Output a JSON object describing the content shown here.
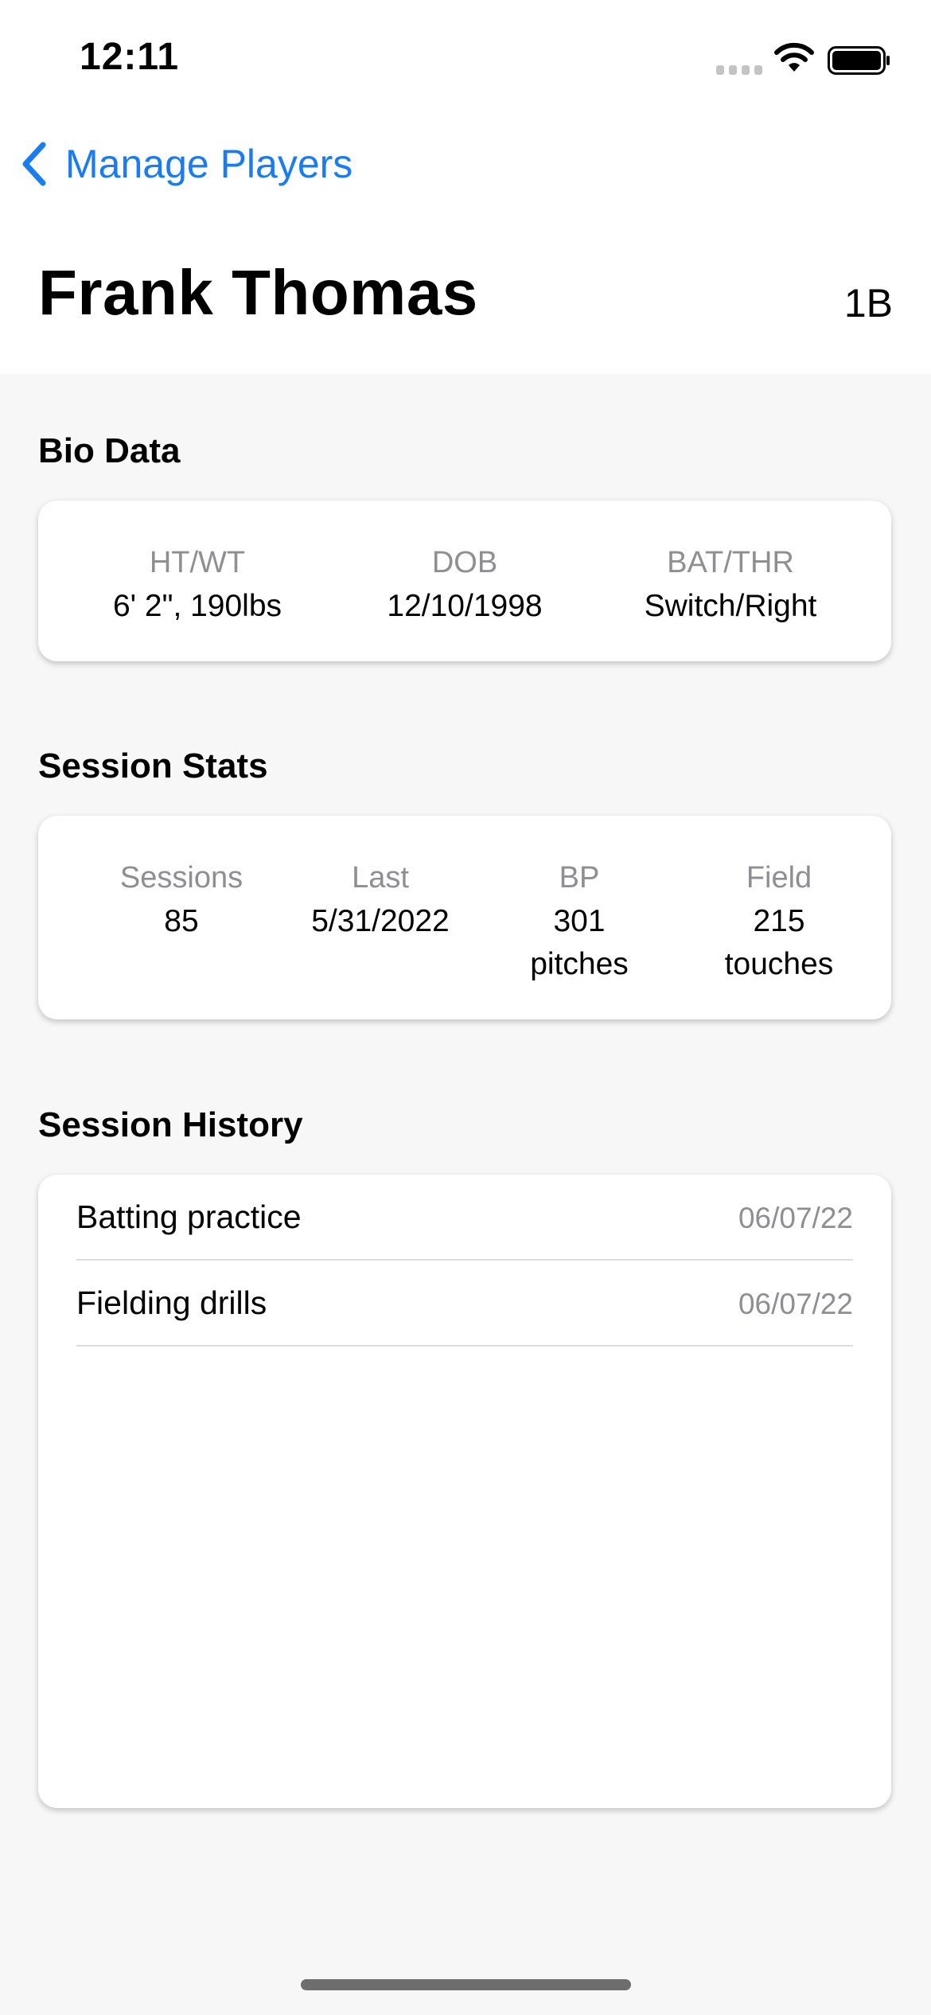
{
  "status_bar": {
    "time": "12:11"
  },
  "nav": {
    "back_label": "Manage Players"
  },
  "player": {
    "name": "Frank Thomas",
    "position": "1B"
  },
  "bio": {
    "title": "Bio Data",
    "items": [
      {
        "label": "HT/WT",
        "value": "6' 2\", 190lbs"
      },
      {
        "label": "DOB",
        "value": "12/10/1998"
      },
      {
        "label": "BAT/THR",
        "value": "Switch/Right"
      }
    ]
  },
  "session_stats": {
    "title": "Session Stats",
    "items": [
      {
        "label": "Sessions",
        "value": "85",
        "unit": ""
      },
      {
        "label": "Last",
        "value": "5/31/2022",
        "unit": ""
      },
      {
        "label": "BP",
        "value": "301",
        "unit": "pitches"
      },
      {
        "label": "Field",
        "value": "215",
        "unit": "touches"
      }
    ]
  },
  "session_history": {
    "title": "Session History",
    "rows": [
      {
        "name": "Batting practice",
        "date": "06/07/22"
      },
      {
        "name": "Fielding drills",
        "date": "06/07/22"
      }
    ]
  },
  "colors": {
    "accent": "#1a7cf3",
    "secondary_text": "#8e8e93",
    "background": "#f7f7f7"
  }
}
